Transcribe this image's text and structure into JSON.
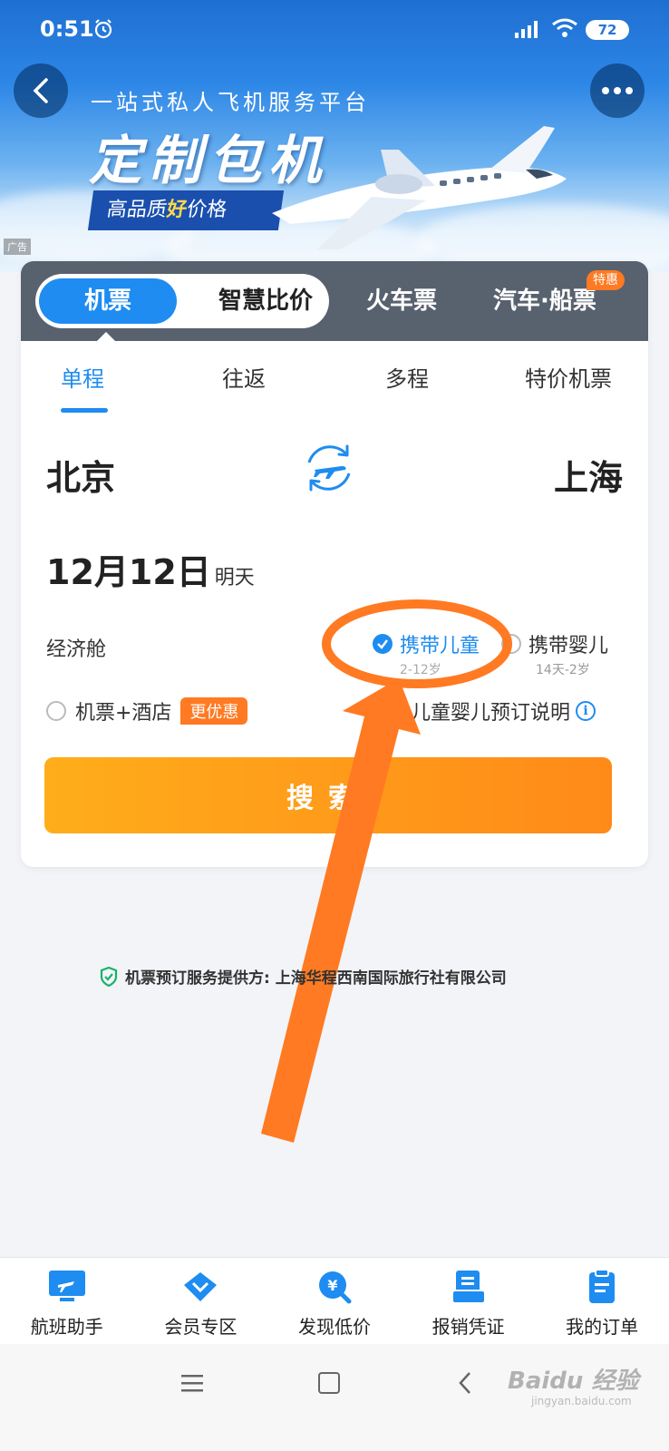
{
  "status_bar": {
    "time": "0:51",
    "battery": "72"
  },
  "banner": {
    "subtitle": "一站式私人飞机服务平台",
    "title": "定制包机",
    "slogan_prefix": "高品质",
    "slogan_highlight": "好",
    "slogan_suffix": "价格",
    "ad_tag": "广告"
  },
  "mode_tabs": {
    "flight": "机票",
    "compare": "智慧比价",
    "train": "火车票",
    "bus_ship": "汽车·船票",
    "special_badge": "特惠"
  },
  "trip_tabs": [
    "单程",
    "往返",
    "多程",
    "特价机票"
  ],
  "route": {
    "from": "北京",
    "to": "上海"
  },
  "date": {
    "main": "12月12日",
    "sub": "明天"
  },
  "cabin": "经济舱",
  "options": {
    "child": "携带儿童",
    "child_age": "2-12岁",
    "infant": "携带婴儿",
    "infant_age": "14天-2岁",
    "hotel": "机票+酒店",
    "hotel_badge": "更优惠",
    "note": "儿童婴儿预订说明"
  },
  "search_label": "搜索",
  "provider": "机票预订服务提供方: 上海华程西南国际旅行社有限公司",
  "bottom_nav": [
    {
      "label": "航班助手",
      "icon": "flight-monitor-icon"
    },
    {
      "label": "会员专区",
      "icon": "diamond-icon"
    },
    {
      "label": "发现低价",
      "icon": "price-search-icon"
    },
    {
      "label": "报销凭证",
      "icon": "receipt-icon"
    },
    {
      "label": "我的订单",
      "icon": "order-icon"
    }
  ],
  "watermark": {
    "brand": "Baidu 经验",
    "url": "jingyan.baidu.com"
  },
  "colors": {
    "primary": "#1e8cf0",
    "accent": "#ff8a19",
    "annotation": "#ff7a22"
  }
}
